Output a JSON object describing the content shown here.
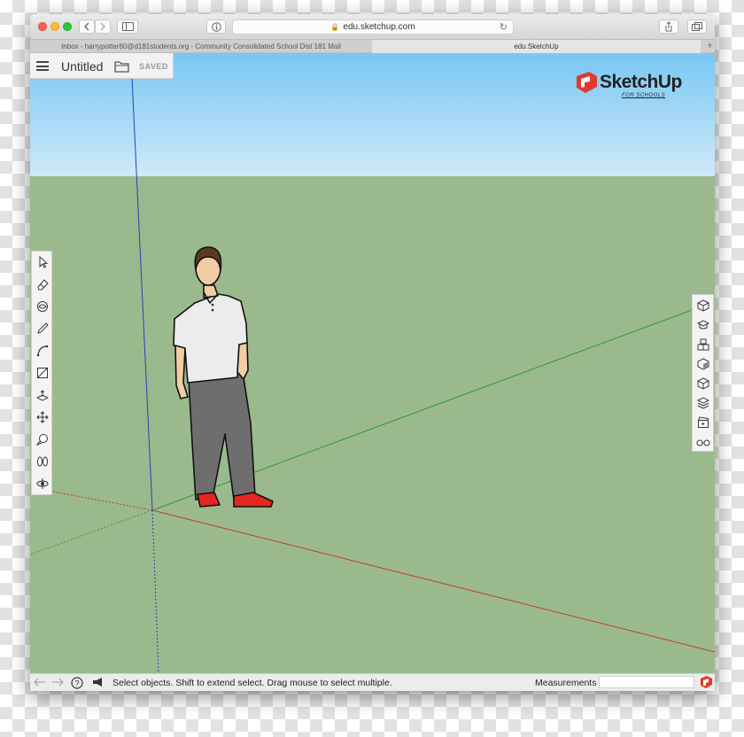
{
  "browser": {
    "url": "edu.sketchup.com",
    "tabs": [
      {
        "label": "Inbox - harrypotter60@d181students.org - Community Consolidated School Dist 181 Mail",
        "active": false
      },
      {
        "label": "edu.SketchUp",
        "active": true
      }
    ]
  },
  "app": {
    "document_title": "Untitled",
    "save_state": "SAVED",
    "logo_text": "SketchUp",
    "logo_subtext": "FOR SCHOOLS"
  },
  "left_toolbar": {
    "tools": [
      "select-tool",
      "eraser-tool",
      "paint-bucket-tool",
      "pencil-tool",
      "arc-tool",
      "rectangle-tool",
      "push-pull-tool",
      "move-tool",
      "tape-measure-tool",
      "walk-tool",
      "orbit-tool"
    ]
  },
  "right_toolbar": {
    "panels": [
      "entity-info-panel",
      "instructor-panel",
      "components-panel",
      "materials-panel",
      "styles-panel",
      "layers-panel",
      "scenes-panel",
      "display-panel"
    ]
  },
  "statusbar": {
    "status_message": "Select objects. Shift to extend select. Drag mouse to select multiple.",
    "measurements_label": "Measurements",
    "measurements_value": ""
  },
  "colors": {
    "sky_top": "#79c7f4",
    "ground": "#9aba8e",
    "axis_red": "#c0392b",
    "axis_green": "#2ea02e",
    "axis_blue": "#2b3fb5",
    "logo_red": "#e03a2f"
  }
}
